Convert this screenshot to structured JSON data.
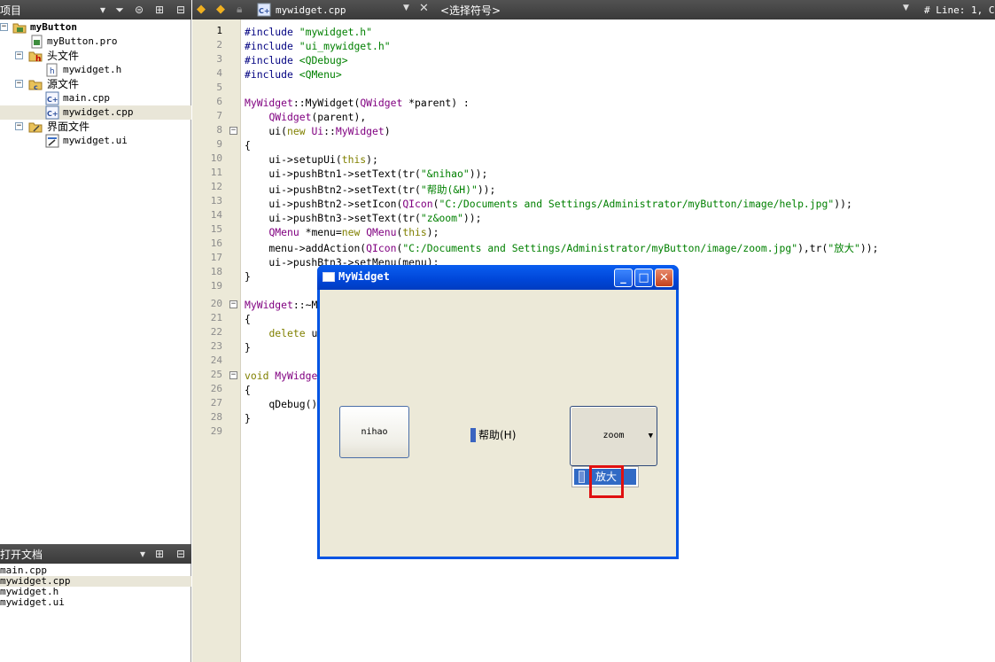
{
  "project_pane": {
    "title": "项目",
    "tree": [
      {
        "label": "myButton"
      },
      {
        "label": "myButton.pro"
      },
      {
        "label": "头文件"
      },
      {
        "label": "mywidget.h"
      },
      {
        "label": "源文件"
      },
      {
        "label": "main.cpp"
      },
      {
        "label": "mywidget.cpp"
      },
      {
        "label": "界面文件"
      },
      {
        "label": "mywidget.ui"
      }
    ]
  },
  "open_docs_pane": {
    "title": "打开文档",
    "items": [
      "main.cpp",
      "mywidget.cpp",
      "mywidget.h",
      "mywidget.ui"
    ]
  },
  "editor_toolbar": {
    "file": "mywidget.cpp",
    "symbol": "<选择符号>",
    "position": "# Line: 1, C"
  },
  "editor": {
    "line_numbers": [
      "1",
      "2",
      "3",
      "4",
      "5",
      "6",
      "7",
      "8",
      "9",
      "10",
      "11",
      "12",
      "13",
      "14",
      "15",
      "16",
      "17",
      "18",
      "19",
      "20",
      "21",
      "22",
      "23",
      "24",
      "25",
      "26",
      "27",
      "28",
      "29"
    ]
  },
  "mywidget_window": {
    "title": "MyWidget",
    "min_glyph": "_",
    "max_glyph": "□",
    "close_glyph": "✕",
    "btn1_text": "nihao",
    "btn2_text": "帮助(H)",
    "btn3_text": "zoom",
    "btn3_arrow": "▼",
    "menu_item": "放大"
  },
  "colors": {
    "keyword": "#808000",
    "type": "#800080",
    "string": "#008000",
    "highlight": "#e01010",
    "menu_selection": "#316ac5"
  }
}
